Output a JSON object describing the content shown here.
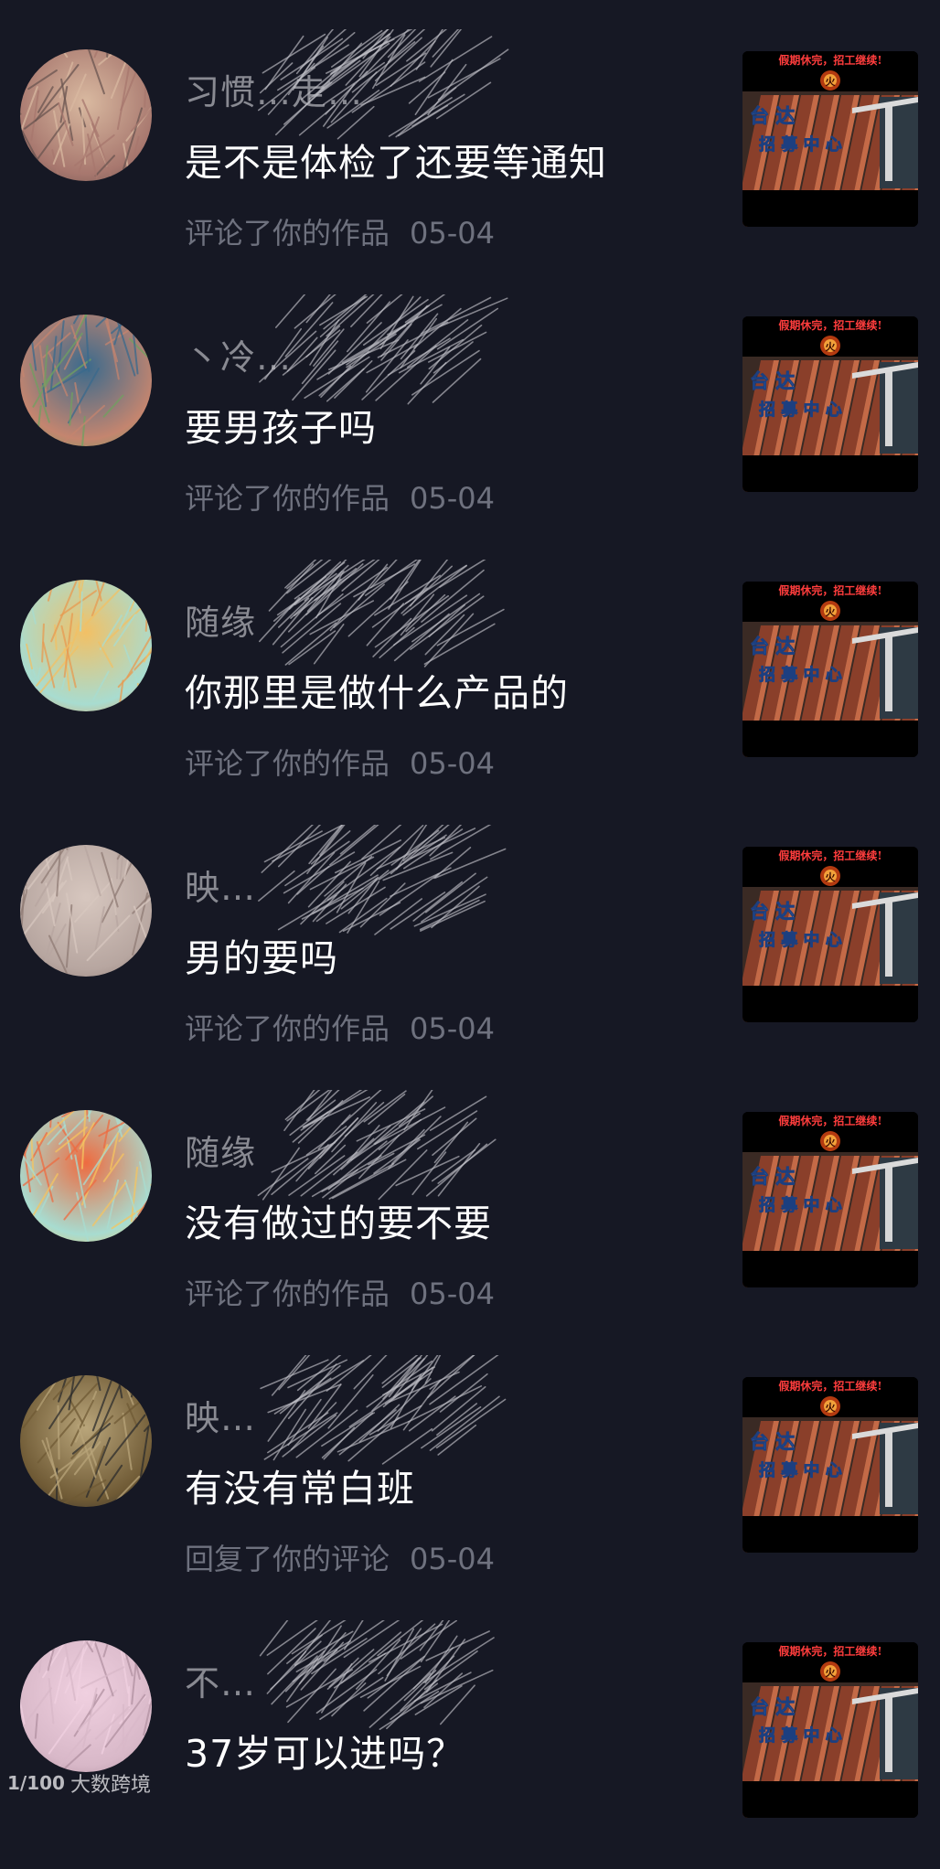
{
  "notifications": [
    {
      "username": "习惯…走…",
      "comment": "是不是体检了还要等通知",
      "action": "评论了你的作品",
      "date": "05-04",
      "avatar_colors": [
        "#a7776e",
        "#d9b9a0",
        "#6a5550"
      ]
    },
    {
      "username": "丶冷…",
      "comment": "要男孩子吗",
      "action": "评论了你的作品",
      "date": "05-04",
      "avatar_colors": [
        "#c4856f",
        "#3a6a8d",
        "#70a060"
      ]
    },
    {
      "username": "随缘",
      "comment": "你那里是做什么产品的",
      "action": "评论了你的作品",
      "date": "05-04",
      "avatar_colors": [
        "#a8dcd0",
        "#f2c065",
        "#e89a50"
      ]
    },
    {
      "username": "映…",
      "comment": "男的要吗",
      "action": "评论了你的作品",
      "date": "05-04",
      "avatar_colors": [
        "#b7a6a0",
        "#d7c7bf",
        "#8f7b75"
      ]
    },
    {
      "username": "随缘",
      "comment": "没有做过的要不要",
      "action": "评论了你的作品",
      "date": "05-04",
      "avatar_colors": [
        "#a8dcd0",
        "#ee6b40",
        "#f5c460"
      ]
    },
    {
      "username": "映…",
      "comment": "有没有常白班",
      "action": "回复了你的评论",
      "date": "05-04",
      "avatar_colors": [
        "#6f5a35",
        "#b9a57a",
        "#2c2c2c"
      ]
    },
    {
      "username": "不…",
      "comment": "37岁可以进吗？",
      "action": "",
      "date": "",
      "avatar_colors": [
        "#d8b8c8",
        "#f0d0e0",
        "#b090a0"
      ]
    }
  ],
  "thumbnail": {
    "banner_text": "假期休完，招工继续!",
    "badge_text": "火",
    "title_line1": "台  达",
    "title_line2": "招 募 中 心",
    "banner_color": "#ff3d3d",
    "title_color": "#6ec3ff"
  },
  "watermark": {
    "logo": "1/100",
    "text": "大数跨境"
  }
}
